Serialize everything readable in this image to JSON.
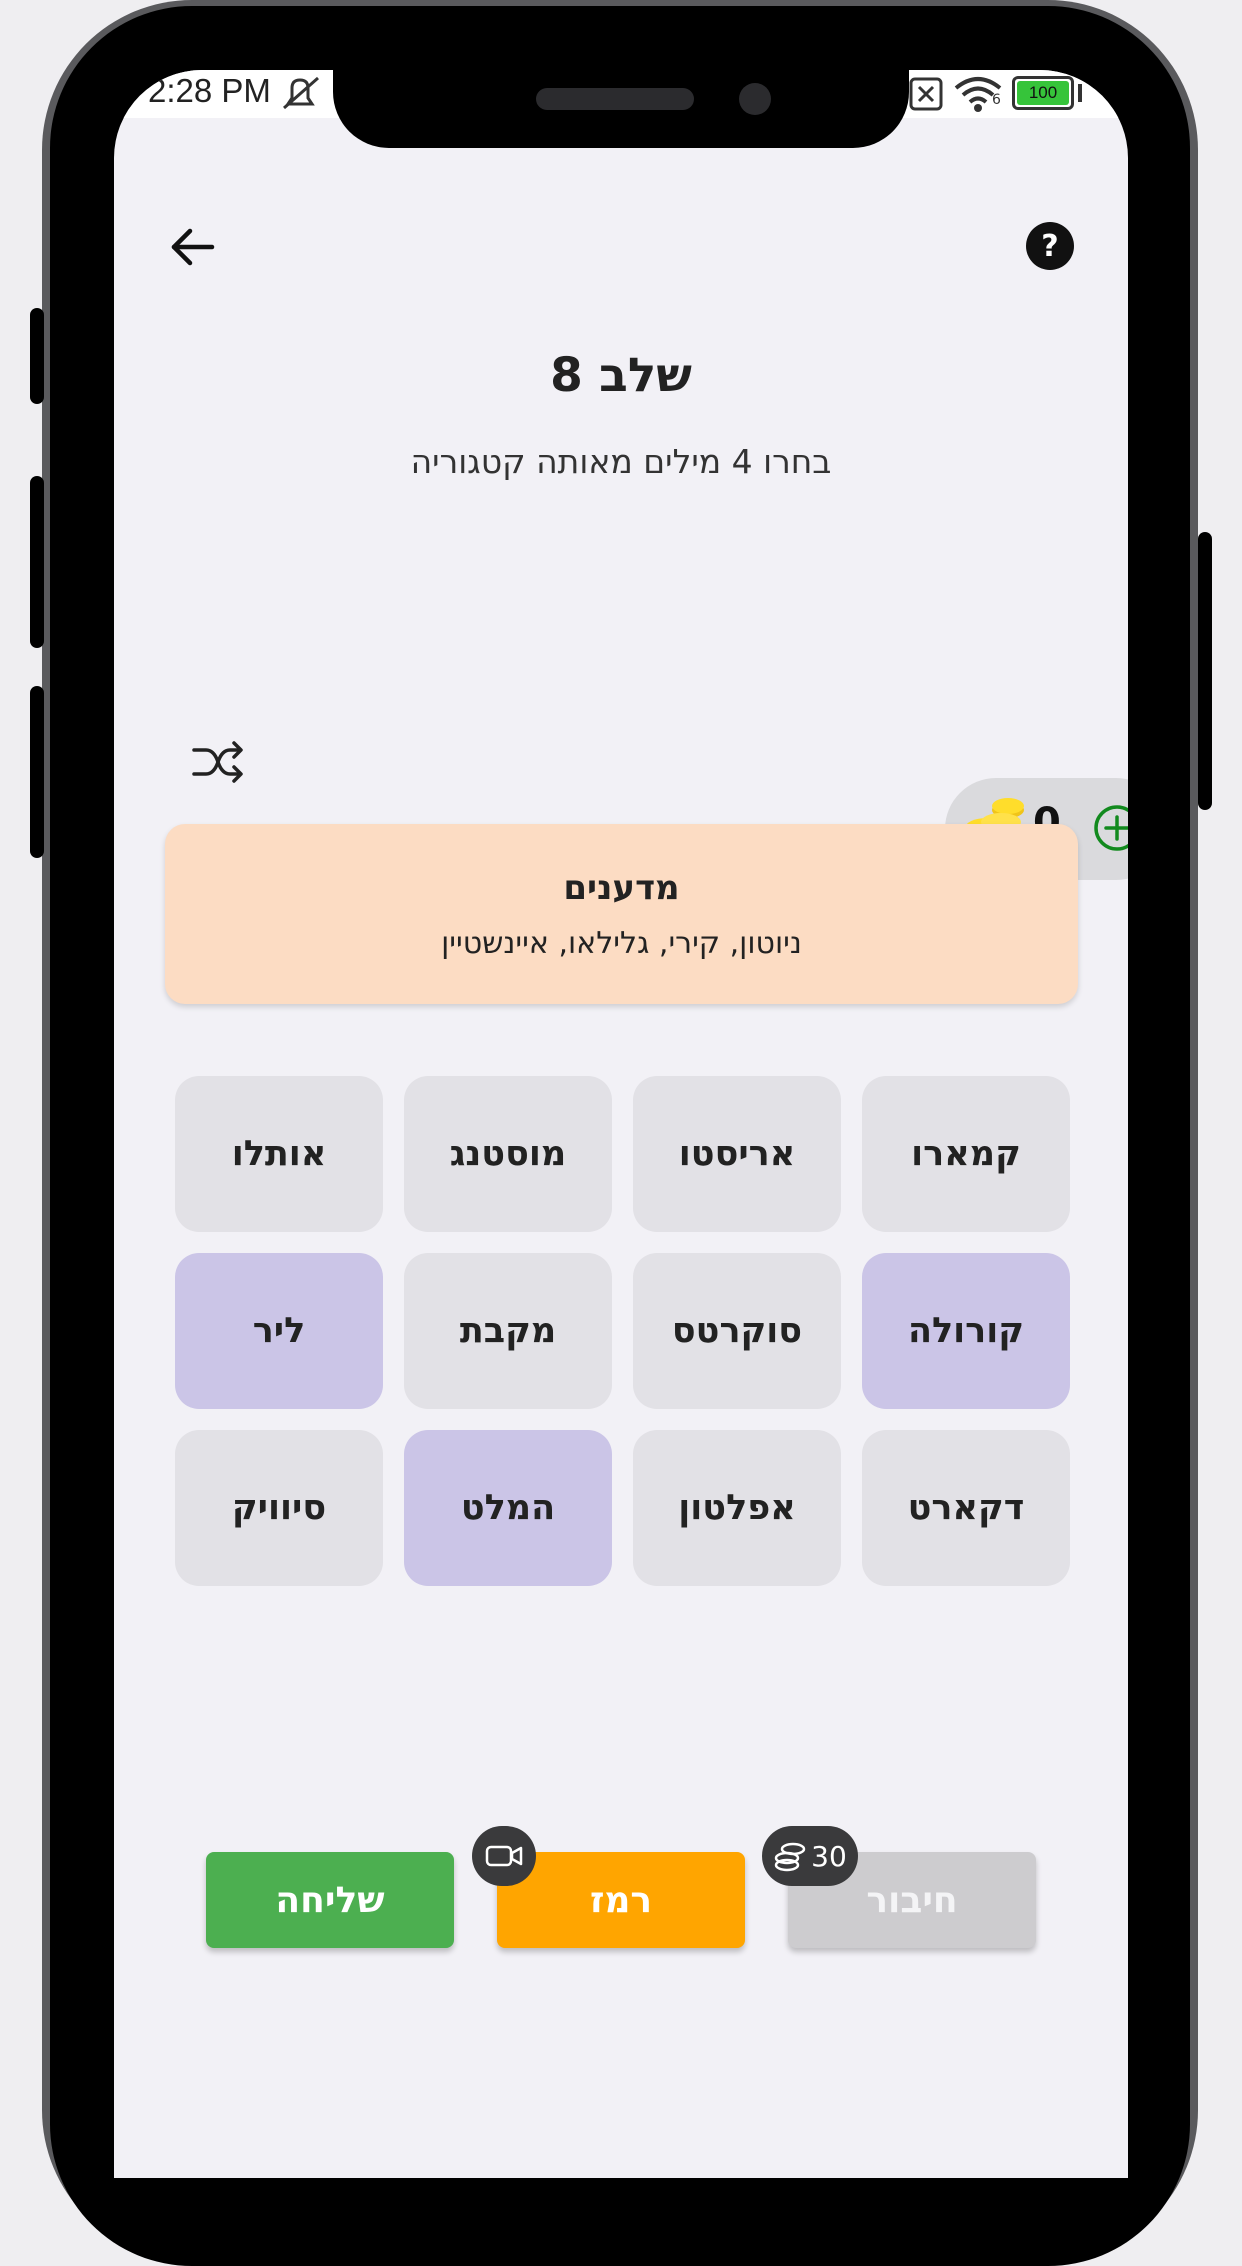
{
  "status": {
    "time": "2:28 PM",
    "battery": "100",
    "wifi_level": "6"
  },
  "header": {
    "back_icon": "arrow-left-icon",
    "help_icon": "question-circle-icon"
  },
  "level": {
    "title": "שלב 8",
    "instruction": "בחרו 4 מילים מאותה קטגוריה"
  },
  "toolbar": {
    "shuffle_icon": "shuffle-icon",
    "coins": "0",
    "coins_icon": "coins-icon",
    "add_icon": "plus-circle-icon"
  },
  "solved_group": {
    "category": "מדענים",
    "words": "ניוטון, קירי, גלילאו, איינשטיין",
    "color": "#fcdcc3"
  },
  "grid": {
    "tiles": [
      {
        "label": "קמארו",
        "selected": false
      },
      {
        "label": "אריסטו",
        "selected": false
      },
      {
        "label": "מוסטנג",
        "selected": false
      },
      {
        "label": "אותלו",
        "selected": false
      },
      {
        "label": "קורולה",
        "selected": true
      },
      {
        "label": "סוקרטס",
        "selected": false
      },
      {
        "label": "מקבת",
        "selected": false
      },
      {
        "label": "ליר",
        "selected": true
      },
      {
        "label": "דקארט",
        "selected": false
      },
      {
        "label": "אפלטון",
        "selected": false
      },
      {
        "label": "המלט",
        "selected": true
      },
      {
        "label": "סיוויק",
        "selected": false
      }
    ],
    "selected_color": "#cbc5e7",
    "default_color": "#e2e1e6"
  },
  "actions": {
    "connect_label": "חיבור",
    "connect_cost": "30",
    "hint_label": "רמז",
    "hint_icon": "video-camera-icon",
    "submit_label": "שליחה",
    "colors": {
      "connect": "#cdcccf",
      "hint": "#ffa500",
      "submit": "#4caf50"
    }
  }
}
